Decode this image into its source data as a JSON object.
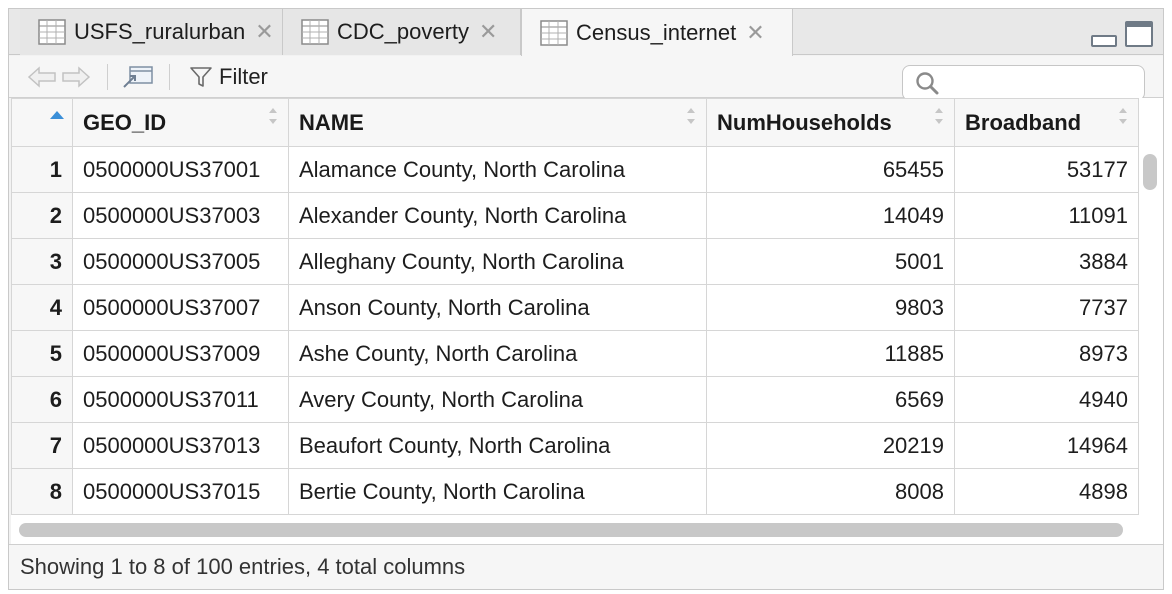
{
  "tabs": [
    {
      "label": "USFS_ruralurban",
      "active": false
    },
    {
      "label": "CDC_poverty",
      "active": false
    },
    {
      "label": "Census_internet",
      "active": true
    }
  ],
  "toolbar": {
    "filter_label": "Filter",
    "search_placeholder": ""
  },
  "table": {
    "columns": [
      "GEO_ID",
      "NAME",
      "NumHouseholds",
      "Broadband"
    ],
    "rows": [
      {
        "n": "1",
        "geo_id": "0500000US37001",
        "name": "Alamance County, North Carolina",
        "households": "65455",
        "broadband": "53177"
      },
      {
        "n": "2",
        "geo_id": "0500000US37003",
        "name": "Alexander County, North Carolina",
        "households": "14049",
        "broadband": "11091"
      },
      {
        "n": "3",
        "geo_id": "0500000US37005",
        "name": "Alleghany County, North Carolina",
        "households": "5001",
        "broadband": "3884"
      },
      {
        "n": "4",
        "geo_id": "0500000US37007",
        "name": "Anson County, North Carolina",
        "households": "9803",
        "broadband": "7737"
      },
      {
        "n": "5",
        "geo_id": "0500000US37009",
        "name": "Ashe County, North Carolina",
        "households": "11885",
        "broadband": "8973"
      },
      {
        "n": "6",
        "geo_id": "0500000US37011",
        "name": "Avery County, North Carolina",
        "households": "6569",
        "broadband": "4940"
      },
      {
        "n": "7",
        "geo_id": "0500000US37013",
        "name": "Beaufort County, North Carolina",
        "households": "20219",
        "broadband": "14964"
      },
      {
        "n": "8",
        "geo_id": "0500000US37015",
        "name": "Bertie County, North Carolina",
        "households": "8008",
        "broadband": "4898"
      }
    ]
  },
  "status": {
    "text": "Showing 1 to 8 of 100 entries, 4 total columns"
  },
  "icons": {
    "tab": "grid-table-icon",
    "close": "close-icon",
    "back": "back-arrow-icon",
    "forward": "forward-arrow-icon",
    "popout": "popout-icon",
    "filter": "filter-funnel-icon",
    "search": "search-icon",
    "minimize": "minimize-pane-icon",
    "maximize": "maximize-pane-icon"
  },
  "colors": {
    "sort_active": "#3b8fd8"
  }
}
